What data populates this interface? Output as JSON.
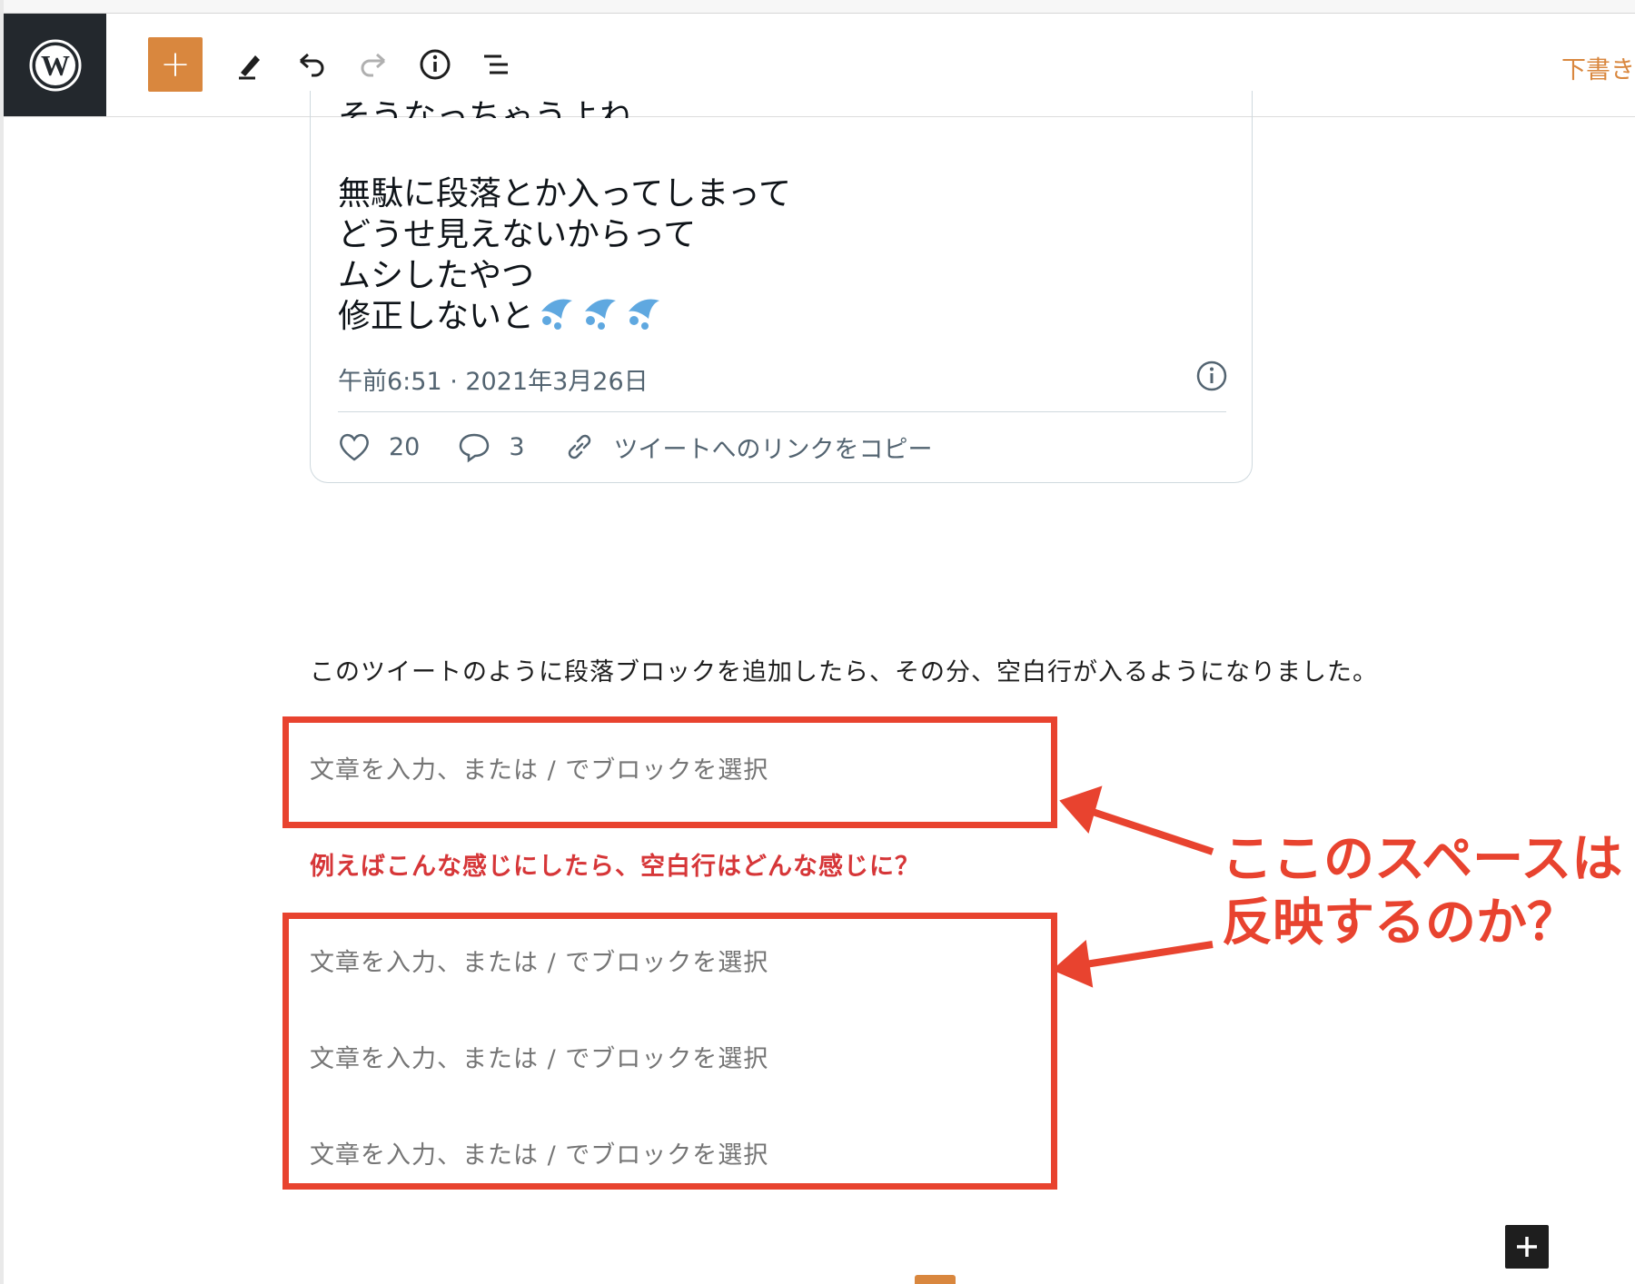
{
  "toolbar": {
    "add_block_label": "+",
    "draft_label": "下書き"
  },
  "tweet": {
    "cut_line": "そうなっちゃうよね",
    "lines": [
      "無駄に段落とか入ってしまって",
      "どうせ見えないからって",
      "ムシしたやつ",
      "修正しないと"
    ],
    "timestamp": "午前6:51 · 2021年3月26日",
    "likes": "20",
    "replies": "3",
    "copy_link": "ツイートへのリンクをコピー"
  },
  "editor": {
    "paragraph": "このツイートのように段落ブロックを追加したら、その分、空白行が入るようになりました。",
    "placeholder": "文章を入力、または / でブロックを選択",
    "red_note": "例えばこんな感じにしたら、空白行はどんな感じに？"
  },
  "annotation": {
    "line1": "ここのスペースは",
    "line2": "反映するのか？"
  },
  "colors": {
    "accent": "#d9873e",
    "annotation_red": "#e8432f",
    "note_red": "#d63638"
  }
}
